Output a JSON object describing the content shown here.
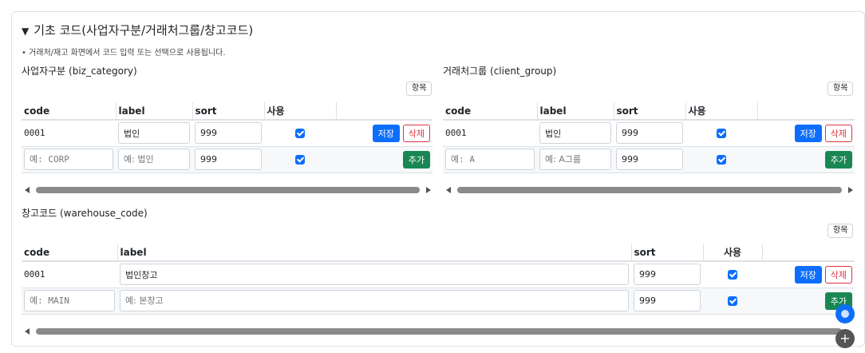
{
  "section": {
    "caret": "▼",
    "title": "기초 코드(사업자구분/거래처그룹/창고코드)",
    "hint": "• 거래처/재고 화면에서 코드 입력 또는 선택으로 사용됩니다."
  },
  "columns_button": "항목",
  "headers": {
    "code": "code",
    "label": "label",
    "sort": "sort",
    "use": "사용"
  },
  "actions": {
    "save": "저장",
    "delete": "삭제",
    "add": "추가"
  },
  "biz": {
    "title": "사업자구분 (biz_category)",
    "row": {
      "code": "0001",
      "label": "법인",
      "sort": "999",
      "use": true
    },
    "new": {
      "code_ph": "예: CORP",
      "label_ph": "예: 법인",
      "sort": "999",
      "use": true
    }
  },
  "client": {
    "title": "거래처그룹 (client_group)",
    "row": {
      "code": "0001",
      "label": "법인",
      "sort": "999",
      "use": true
    },
    "new": {
      "code_ph": "예: A",
      "label_ph": "예: A그룹",
      "sort": "999",
      "use": true
    }
  },
  "warehouse": {
    "title": "창고코드 (warehouse_code)",
    "row": {
      "code": "0001",
      "label": "법인창고",
      "sort": "999",
      "use": true
    },
    "new": {
      "code_ph": "예: MAIN",
      "label_ph": "예: 본창고",
      "sort": "999",
      "use": true
    }
  },
  "fab": {
    "plus": "+"
  },
  "colors": {
    "primary": "#0d6efd",
    "danger": "#dc3545",
    "success": "#198754"
  }
}
